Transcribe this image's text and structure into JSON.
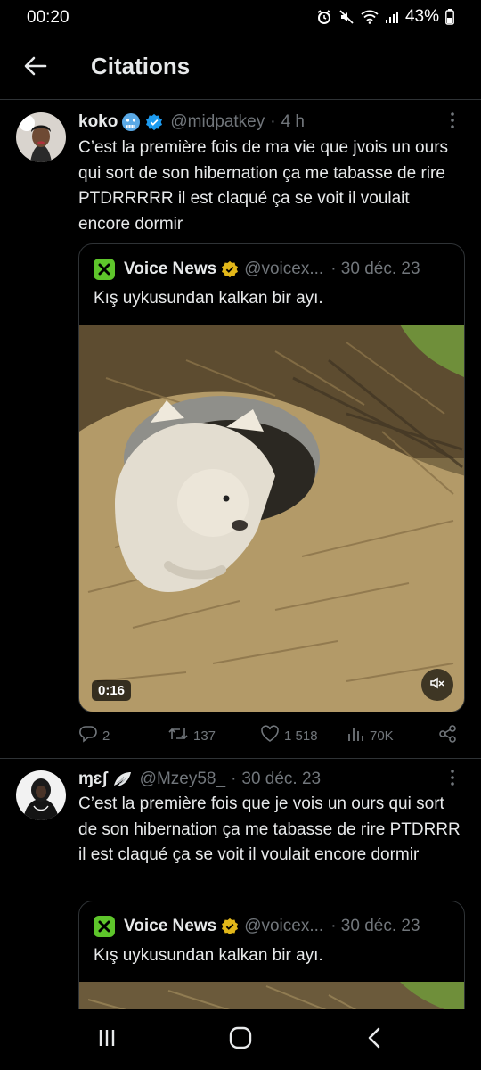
{
  "status_bar": {
    "time": "00:20",
    "battery": "43%"
  },
  "header": {
    "title": "Citations"
  },
  "tweets": [
    {
      "name": "koko",
      "handle": "@midpatkey",
      "dot": "·",
      "time": "4 h",
      "text": "C’est la première fois de ma vie que jvois un ours qui sort de son hibernation ça me tabasse de rire PTDRRRRR il est claqué ça se voit il voulait encore dormir",
      "quote": {
        "name": "Voice News",
        "handle": "@voicex...",
        "time": "· 30 déc. 23",
        "text": "Kış uykusundan kalkan bir ayı.",
        "duration": "0:16"
      },
      "stats": {
        "replies": "2",
        "reposts": "137",
        "likes": "1 518",
        "views": "70K"
      }
    },
    {
      "name": "ɱɛʃ",
      "handle": "@Mzey58_",
      "dot": "·",
      "time": "30 déc. 23",
      "text": "C’est la première fois que je vois un ours qui sort de son hibernation ça me tabasse de rire PTDRRR il est claqué ça se voit il voulait encore dormir",
      "quote": {
        "name": "Voice News",
        "handle": "@voicex...",
        "time": "· 30 déc. 23",
        "text": "Kış uykusundan kalkan bir ayı."
      }
    }
  ],
  "colors": {
    "background": "#000000",
    "text": "#e7e9ea",
    "muted": "#71767b",
    "verified": "#1d9bf0",
    "gold": "#e2b719",
    "brand_green": "#5ec52b"
  },
  "icons": [
    "back-arrow-icon",
    "more-icon",
    "verified-icon",
    "reply-icon",
    "repost-icon",
    "like-icon",
    "views-icon",
    "share-icon",
    "mute-icon"
  ]
}
